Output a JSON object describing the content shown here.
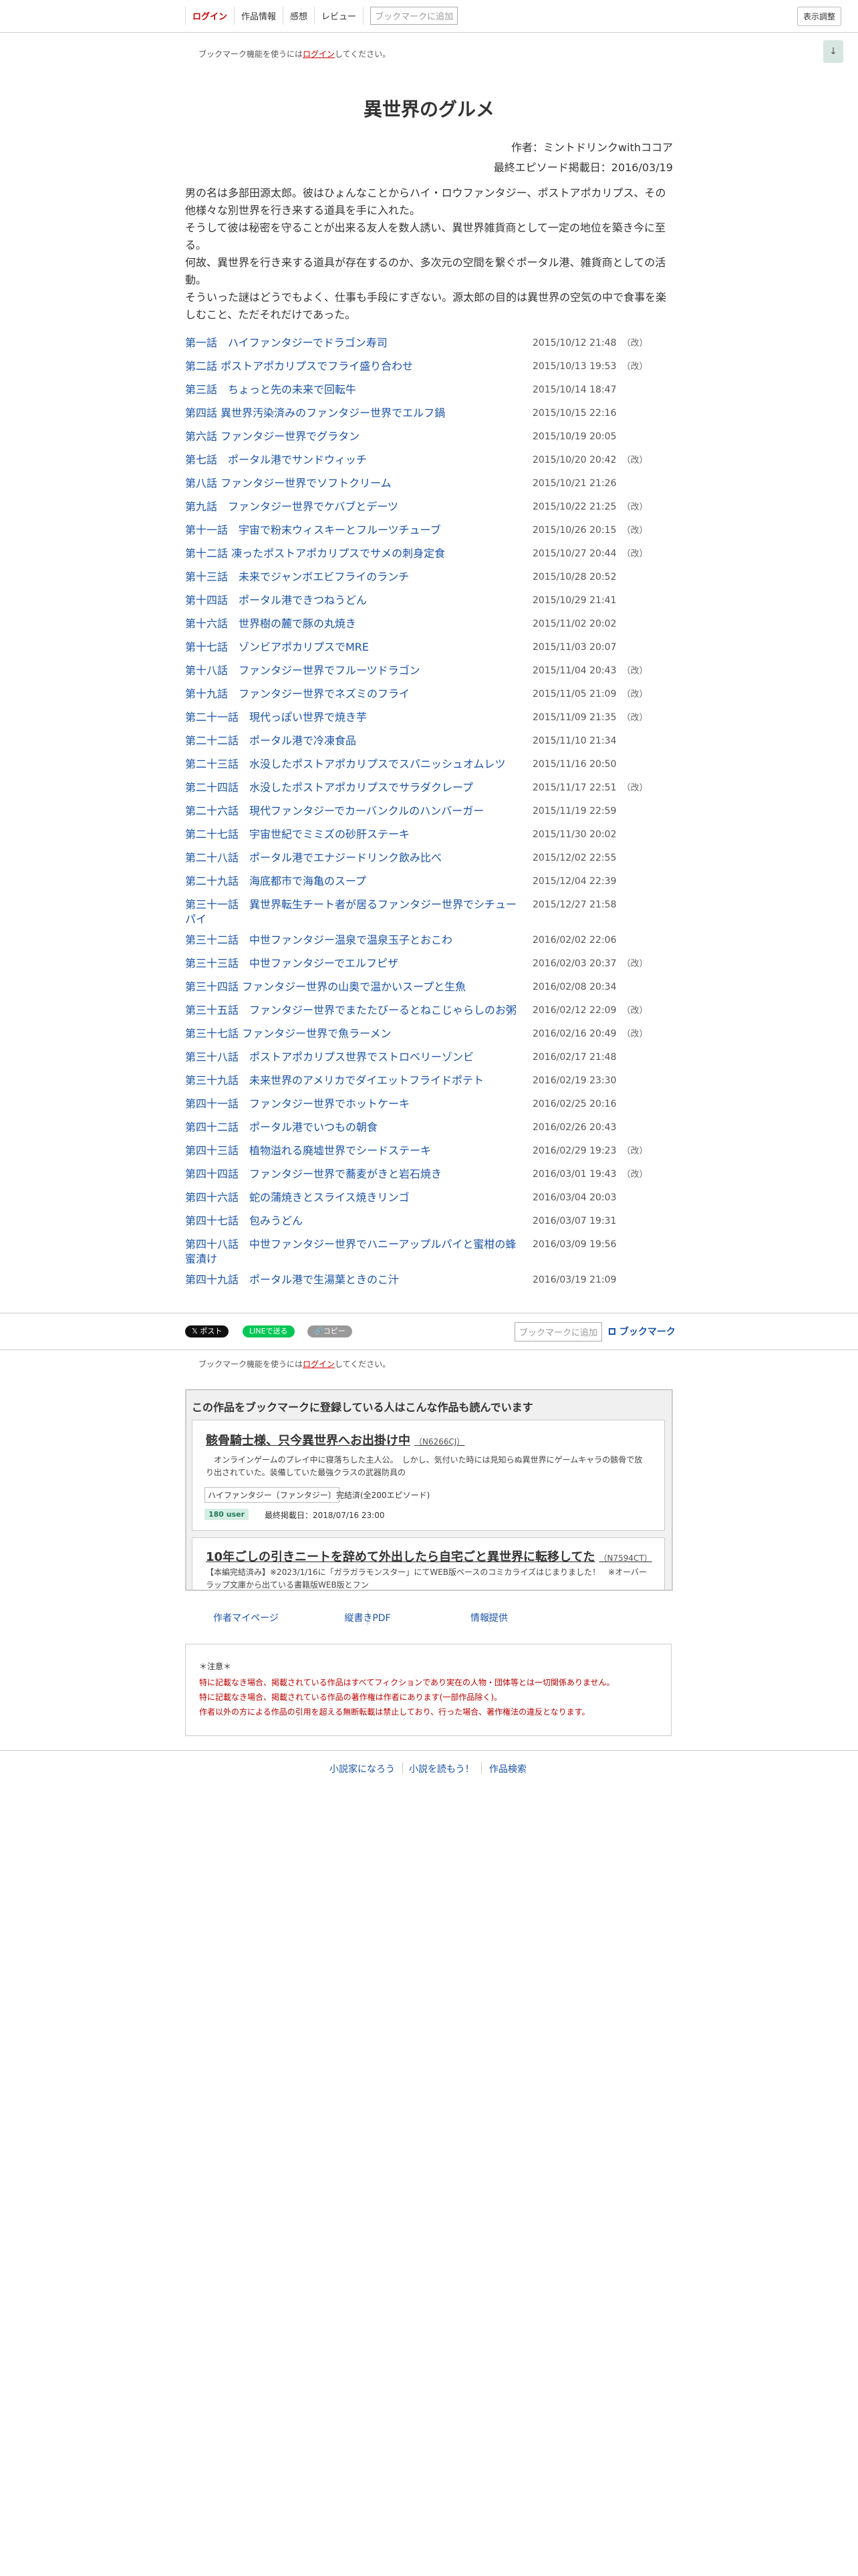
{
  "nav": {
    "login": "ログイン",
    "info": "作品情報",
    "impressions": "感想",
    "review": "レビュー",
    "bookmark_add": "ブックマークに追加",
    "display_settings": "表示調整"
  },
  "bookmark_notice": {
    "prefix": "ブックマーク機能を使うには",
    "link": "ログイン",
    "suffix": "してください。"
  },
  "scroll_icon": "↓",
  "novel": {
    "title": "異世界のグルメ",
    "author": "作者：ミントドリンクwithココア",
    "last_episode": "最終エピソード掲載日：2016/03/19",
    "synopsis": [
      "男の名は多部田源太郎。彼はひょんなことからハイ・ロウファンタジー、ポストアポカリプス、その他様々な別世界を行き来する道具を手に入れた。",
      "そうして彼は秘密を守ることが出来る友人を数人誘い、異世界雑貨商として一定の地位を築き今に至る。",
      "何故、異世界を行き来する道具が存在するのか、多次元の空間を繋ぐポータル港、雑貨商としての活動。",
      "そういった謎はどうでもよく、仕事も手段にすぎない。源太郎の目的は異世界の空気の中で食事を楽しむこと、ただそれだけであった。"
    ]
  },
  "chapters": [
    {
      "title": "第一話　ハイファンタジーでドラゴン寿司",
      "date": "2015/10/12 21:48",
      "revised": "（改）"
    },
    {
      "title": "第二話 ポストアポカリプスでフライ盛り合わせ",
      "date": "2015/10/13 19:53",
      "revised": "（改）"
    },
    {
      "title": "第三話　ちょっと先の未来で回転牛",
      "date": "2015/10/14 18:47",
      "revised": ""
    },
    {
      "title": "第四話 異世界汚染済みのファンタジー世界でエルフ鍋",
      "date": "2015/10/15 22:16",
      "revised": ""
    },
    {
      "title": "第六話 ファンタジー世界でグラタン",
      "date": "2015/10/19 20:05",
      "revised": ""
    },
    {
      "title": "第七話　ポータル港でサンドウィッチ",
      "date": "2015/10/20 20:42",
      "revised": "（改）"
    },
    {
      "title": "第八話 ファンタジー世界でソフトクリーム",
      "date": "2015/10/21 21:26",
      "revised": ""
    },
    {
      "title": "第九話　ファンタジー世界でケバブとデーツ",
      "date": "2015/10/22 21:25",
      "revised": "（改）"
    },
    {
      "title": "第十一話　宇宙で粉末ウィスキーとフルーツチューブ",
      "date": "2015/10/26 20:15",
      "revised": "（改）"
    },
    {
      "title": "第十二話 凍ったポストアポカリプスでサメの刺身定食",
      "date": "2015/10/27 20:44",
      "revised": "（改）"
    },
    {
      "title": "第十三話　未来でジャンボエビフライのランチ",
      "date": "2015/10/28 20:52",
      "revised": ""
    },
    {
      "title": "第十四話　ポータル港できつねうどん",
      "date": "2015/10/29 21:41",
      "revised": ""
    },
    {
      "title": "第十六話　世界樹の麓で豚の丸焼き",
      "date": "2015/11/02 20:02",
      "revised": ""
    },
    {
      "title": "第十七話　ゾンビアポカリプスでMRE",
      "date": "2015/11/03 20:07",
      "revised": ""
    },
    {
      "title": "第十八話　ファンタジー世界でフルーツドラゴン",
      "date": "2015/11/04 20:43",
      "revised": "（改）"
    },
    {
      "title": "第十九話　ファンタジー世界でネズミのフライ",
      "date": "2015/11/05 21:09",
      "revised": "（改）"
    },
    {
      "title": "第二十一話　現代っぽい世界で焼き芋",
      "date": "2015/11/09 21:35",
      "revised": "（改）"
    },
    {
      "title": "第二十二話　ポータル港で冷凍食品",
      "date": "2015/11/10 21:34",
      "revised": ""
    },
    {
      "title": "第二十三話　水没したポストアポカリプスでスパニッシュオムレツ",
      "date": "2015/11/16 20:50",
      "revised": ""
    },
    {
      "title": "第二十四話　水没したポストアポカリプスでサラダクレープ",
      "date": "2015/11/17 22:51",
      "revised": "（改）"
    },
    {
      "title": "第二十六話　現代ファンタジーでカーバンクルのハンバーガー",
      "date": "2015/11/19 22:59",
      "revised": ""
    },
    {
      "title": "第二十七話　宇宙世紀でミミズの砂肝ステーキ",
      "date": "2015/11/30 20:02",
      "revised": ""
    },
    {
      "title": "第二十八話　ポータル港でエナジードリンク飲み比べ",
      "date": "2015/12/02 22:55",
      "revised": ""
    },
    {
      "title": "第二十九話　海底都市で海亀のスープ",
      "date": "2015/12/04 22:39",
      "revised": ""
    },
    {
      "title": "第三十一話　異世界転生チート者が居るファンタジー世界でシチューパイ",
      "date": "2015/12/27 21:58",
      "revised": ""
    },
    {
      "title": "第三十二話　中世ファンタジー温泉で温泉玉子とおこわ",
      "date": "2016/02/02 22:06",
      "revised": ""
    },
    {
      "title": "第三十三話　中世ファンタジーでエルフピザ",
      "date": "2016/02/03 20:37",
      "revised": "（改）"
    },
    {
      "title": "第三十四話 ファンタジー世界の山奥で温かいスープと生魚",
      "date": "2016/02/08 20:34",
      "revised": ""
    },
    {
      "title": "第三十五話　ファンタジー世界でまたたびーるとねこじゃらしのお粥",
      "date": "2016/02/12 22:09",
      "revised": "（改）"
    },
    {
      "title": "第三十七話 ファンタジー世界で魚ラーメン",
      "date": "2016/02/16 20:49",
      "revised": "（改）"
    },
    {
      "title": "第三十八話　ポストアポカリプス世界でストロベリーゾンビ",
      "date": "2016/02/17 21:48",
      "revised": ""
    },
    {
      "title": "第三十九話　未来世界のアメリカでダイエットフライドポテト",
      "date": "2016/02/19 23:30",
      "revised": ""
    },
    {
      "title": "第四十一話　ファンタジー世界でホットケーキ",
      "date": "2016/02/25 20:16",
      "revised": ""
    },
    {
      "title": "第四十二話　ポータル港でいつもの朝食",
      "date": "2016/02/26 20:43",
      "revised": ""
    },
    {
      "title": "第四十三話　植物溢れる廃墟世界でシードステーキ",
      "date": "2016/02/29 19:23",
      "revised": "（改）"
    },
    {
      "title": "第四十四話　ファンタジー世界で蕎麦がきと岩石焼き",
      "date": "2016/03/01 19:43",
      "revised": "（改）"
    },
    {
      "title": "第四十六話　蛇の蒲焼きとスライス焼きリンゴ",
      "date": "2016/03/04 20:03",
      "revised": ""
    },
    {
      "title": "第四十七話　包みうどん",
      "date": "2016/03/07 19:31",
      "revised": ""
    },
    {
      "title": "第四十八話　中世ファンタジー世界でハニーアップルパイと蜜柑の蜂蜜漬け",
      "date": "2016/03/09 19:56",
      "revised": ""
    },
    {
      "title": "第四十九話　ポータル港で生湯葉ときのこ汁",
      "date": "2016/03/19 21:09",
      "revised": ""
    }
  ],
  "share": {
    "x": "𝕏 ポスト",
    "line": "LINEで送る",
    "copy": "🔗コピー",
    "bookmark_add": "ブックマークに追加",
    "bookmark": "ブックマーク"
  },
  "recommend": {
    "heading": "この作品をブックマークに登録している人はこんな作品も読んでいます",
    "items": [
      {
        "title": "骸骨騎士様、只今異世界へお出掛け中",
        "ncode": "（N6266CJ）",
        "desc": "　オンラインゲームのプレイ中に寝落ちした主人公。　しかし、気付いた時には見知らぬ異世界にゲームキャラの骸骨で放り出されていた。装備していた最強クラスの武器防具の",
        "genre": "ハイファンタジー〔ファンタジー〕",
        "status": "完結済(全200エピソード)",
        "users": "180 user",
        "updated": "最終掲載日：2018/07/16 23:00"
      },
      {
        "title": "10年ごしの引きニートを辞めて外出したら自宅ごと異世界に転移してた",
        "ncode": "（N7594CT）",
        "desc": "【本編完結済み】※2023/1/16に「ガラガラモンスター」にてWEB版ベースのコミカライズはじまりました！　※オーバーラップ文庫から出ている書籍版WEB版とフン"
      }
    ]
  },
  "links": {
    "author_page": "作者マイページ",
    "pdf": "縦書きPDF",
    "info": "情報提供"
  },
  "notice": {
    "heading": "＊注意＊",
    "lines": [
      "特に記載なき場合、掲載されている作品はすべてフィクションであり実在の人物・団体等とは一切関係ありません。",
      "特に記載なき場合、掲載されている作品の著作権は作者にあります(一部作品除く)。",
      "作者以外の方による作品の引用を超える無断転載は禁止しており、行った場合、著作権法の違反となります。"
    ]
  },
  "bottom": {
    "naro": "小説家になろう",
    "yomou": "小説を読もう！",
    "search": "作品検索"
  }
}
